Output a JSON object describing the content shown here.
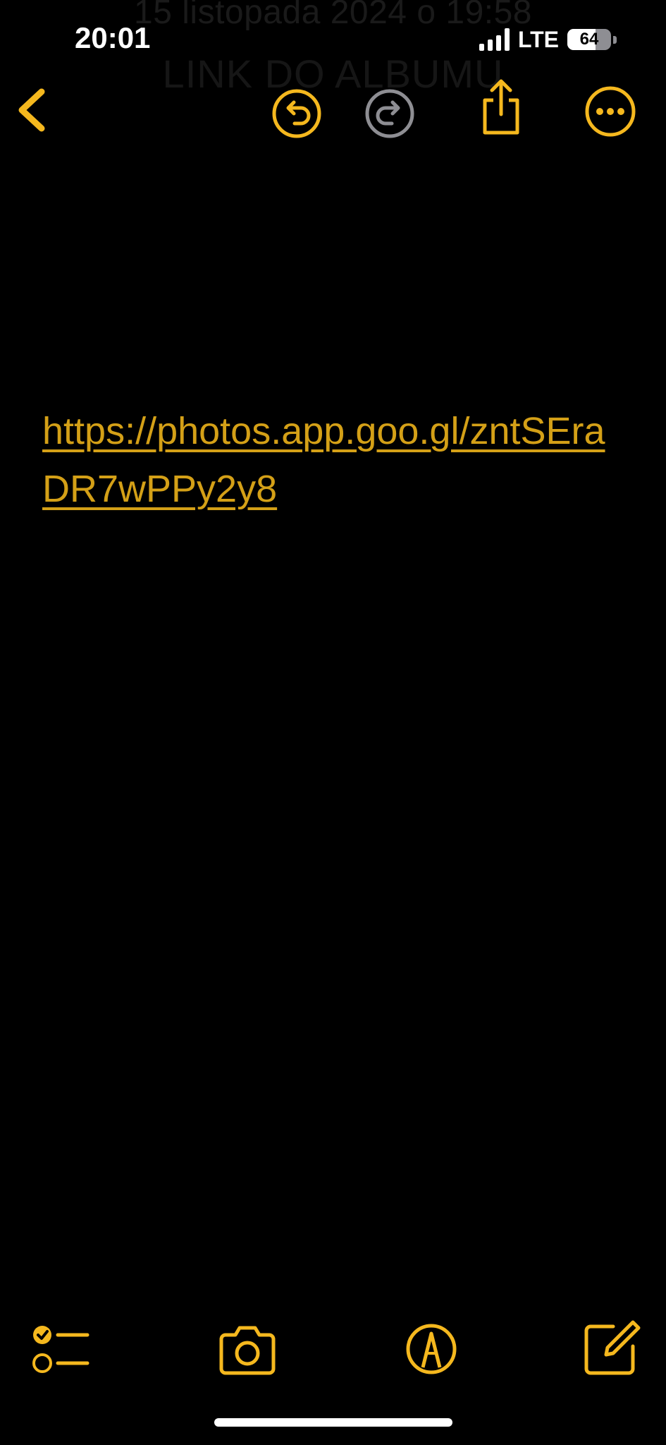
{
  "ghost_header": {
    "date_text": "15 listopada 2024 o 19:58",
    "title_text": "LINK DO ALBUMU"
  },
  "status_bar": {
    "time": "20:01",
    "network": "LTE",
    "battery_percent": "64",
    "battery_level": 0.64
  },
  "top_toolbar": {
    "icons": [
      "chevron-left-icon",
      "undo-icon",
      "redo-icon",
      "share-icon",
      "more-icon"
    ],
    "redo_enabled": false
  },
  "note": {
    "link_text": "https://photos.app.goo.gl/zntSEraDR7wPPy2y8"
  },
  "bottom_toolbar": {
    "icons": [
      "checklist-icon",
      "camera-icon",
      "markup-icon",
      "compose-icon"
    ]
  },
  "colors": {
    "accent": "#f5b81e",
    "link": "#d4a017",
    "disabled": "#8e8e93",
    "background": "#000000",
    "text": "#ffffff"
  }
}
